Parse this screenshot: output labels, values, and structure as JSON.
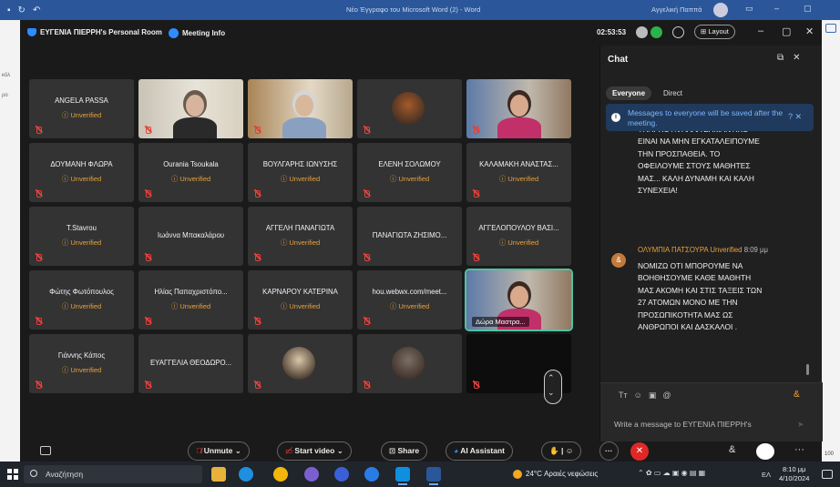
{
  "word": {
    "title": "Νέο Έγγραφο του Microsoft Word (2) - Word",
    "user": "Αγγελική Παππά",
    "left_labels": [
      "κόλ",
      "ρο"
    ],
    "zoom_pct": "100"
  },
  "zoom": {
    "room_title": "ΕΥΓΕΝΙΑ ΠΙΕΡΡΗ's Personal Room",
    "meeting_info": "Meeting Info",
    "timer": "02:53:53",
    "layout_label": "Layout"
  },
  "participants": [
    {
      "name": "ANGELA PASSA",
      "status": "Unverified",
      "kind": "name"
    },
    {
      "name": "",
      "status": "",
      "kind": "video"
    },
    {
      "name": "",
      "status": "",
      "kind": "video"
    },
    {
      "name": "",
      "status": "",
      "kind": "avatar"
    },
    {
      "name": "",
      "status": "",
      "kind": "video"
    },
    {
      "name": "ΔΟΥΜΑΝΗ ΦΛΩΡΑ",
      "status": "Unverified",
      "kind": "name"
    },
    {
      "name": "Ourania Tsoukala",
      "status": "Unverified",
      "kind": "name"
    },
    {
      "name": "ΒΟΥΛΓΑΡΗΣ ΙΩΝΥΣΗΣ",
      "status": "Unverified",
      "kind": "name"
    },
    {
      "name": "ΕΛΕΝΗ ΣΟΛΩΜΟΥ",
      "status": "Unverified",
      "kind": "name"
    },
    {
      "name": "ΚΑΛΑΜΑΚΗ ΑΝΑΣΤΑΣ...",
      "status": "Unverified",
      "kind": "name"
    },
    {
      "name": "T.Stavrou",
      "status": "Unverified",
      "kind": "name"
    },
    {
      "name": "Ιωάννα Μπακαλάρου",
      "status": "",
      "kind": "name"
    },
    {
      "name": "ΑΓΓΕΛΗ ΠΑΝΑΓΙΩΤΑ",
      "status": "Unverified",
      "kind": "name"
    },
    {
      "name": "ΠΑΝΑΓΙΩΤΑ ΖΗΣΙΜΟ...",
      "status": "",
      "kind": "name"
    },
    {
      "name": "ΑΓΓΕΛΟΠΟΥΛΟΥ ΒΑΣΙ...",
      "status": "Unverified",
      "kind": "name"
    },
    {
      "name": "Φώτης Φωτόπουλος",
      "status": "Unverified",
      "kind": "name"
    },
    {
      "name": "Ηλίας Παπαχριστόπο...",
      "status": "Unverified",
      "kind": "name"
    },
    {
      "name": "ΚΑΡΝΑΡΟΥ ΚΑΤΕΡΙΝΑ",
      "status": "Unverified",
      "kind": "name"
    },
    {
      "name": "hou.webwx.com/meet...",
      "status": "Unverified",
      "kind": "name"
    },
    {
      "name": "Δώρα Μαστρα...",
      "status": "",
      "kind": "active-video"
    },
    {
      "name": "Γιάννης Κάπος",
      "status": "Unverified",
      "kind": "name"
    },
    {
      "name": "ΕΥΑΓΓΕΛΙΑ ΘΕΟΔΩΡΟ...",
      "status": "",
      "kind": "name"
    },
    {
      "name": "",
      "status": "",
      "kind": "avatar"
    },
    {
      "name": "",
      "status": "",
      "kind": "avatar"
    },
    {
      "name": "",
      "status": "",
      "kind": "dark"
    }
  ],
  "chat": {
    "title": "Chat",
    "tabs": [
      "Everyone",
      "Direct"
    ],
    "notice": "Messages to everyone will be saved after the meeting.",
    "msg1_lines": [
      "ΥΠΑΡΧΟΥΝ ΑΛΛΑ ΣΗΜΑΝΤΙΚΟ",
      "ΕΙΝΑΙ ΝΑ ΜΗΝ ΕΓΚΑΤΑΛΕΙΠΟΥΜΕ",
      "ΤΗΝ ΠΡΟΣΠΑΘΕΙΑ. ΤΟ",
      "ΟΦΕΙΛΟΥΜΕ ΣΤΟΥΣ ΜΑΘΗΤΕΣ",
      "ΜΑΣ... ΚΑΛΗ ΔΥΝΑΜΗ ΚΑΙ ΚΑΛΗ",
      "ΣΥΝΕΧΕΙΑ!"
    ],
    "msg2_sender": "ΟΛΥΜΠΙΑ ΠΑΤΣΟΥΡΑ",
    "msg2_badge": "Unverified",
    "msg2_time": "8:09 μμ",
    "msg2_lines": [
      "ΝΟΜΙΖΩ ΟΤΙ ΜΠΟΡΟΥΜΕ ΝΑ",
      "ΒΟΗΘΗΣΟΥΜΕ ΚΑΘΕ ΜΑΘΗΤΗ",
      "ΜΑΣ ΑΚΟΜΗ ΚΑΙ ΣΤΙΣ ΤΑΞΕΙΣ ΤΩΝ",
      "27 ΑΤΟΜΩΝ ΜΟΝΟ ΜΕ ΤΗΝ",
      "ΠΡΟΣΩΠΙΚΟΤΗΤΑ ΜΑΣ ΩΣ",
      "ΑΝΘΡΩΠΟΙ  ΚΑΙ ΔΑΣΚΑΛΟΙ ."
    ],
    "input_placeholder": "Write a message to ΕΥΓΕΝΙΑ ΠΙΕΡΡΗ's"
  },
  "toolbar": {
    "unmute": "Unmute",
    "start_video": "Start video",
    "share": "Share",
    "ai_assistant": "AI Assistant"
  },
  "taskbar": {
    "search_placeholder": "Αναζήτηση",
    "weather": "24°C  Αραιές νεφώσεις",
    "lang": "ΕΛ",
    "time": "8:10 μμ",
    "date": "4/10/2024"
  },
  "colors": {
    "accent": "#2d8cff",
    "unverified": "#e9a23b",
    "mute": "#e5403a",
    "end": "#e02828",
    "active_outline": "#4fc3a1"
  }
}
